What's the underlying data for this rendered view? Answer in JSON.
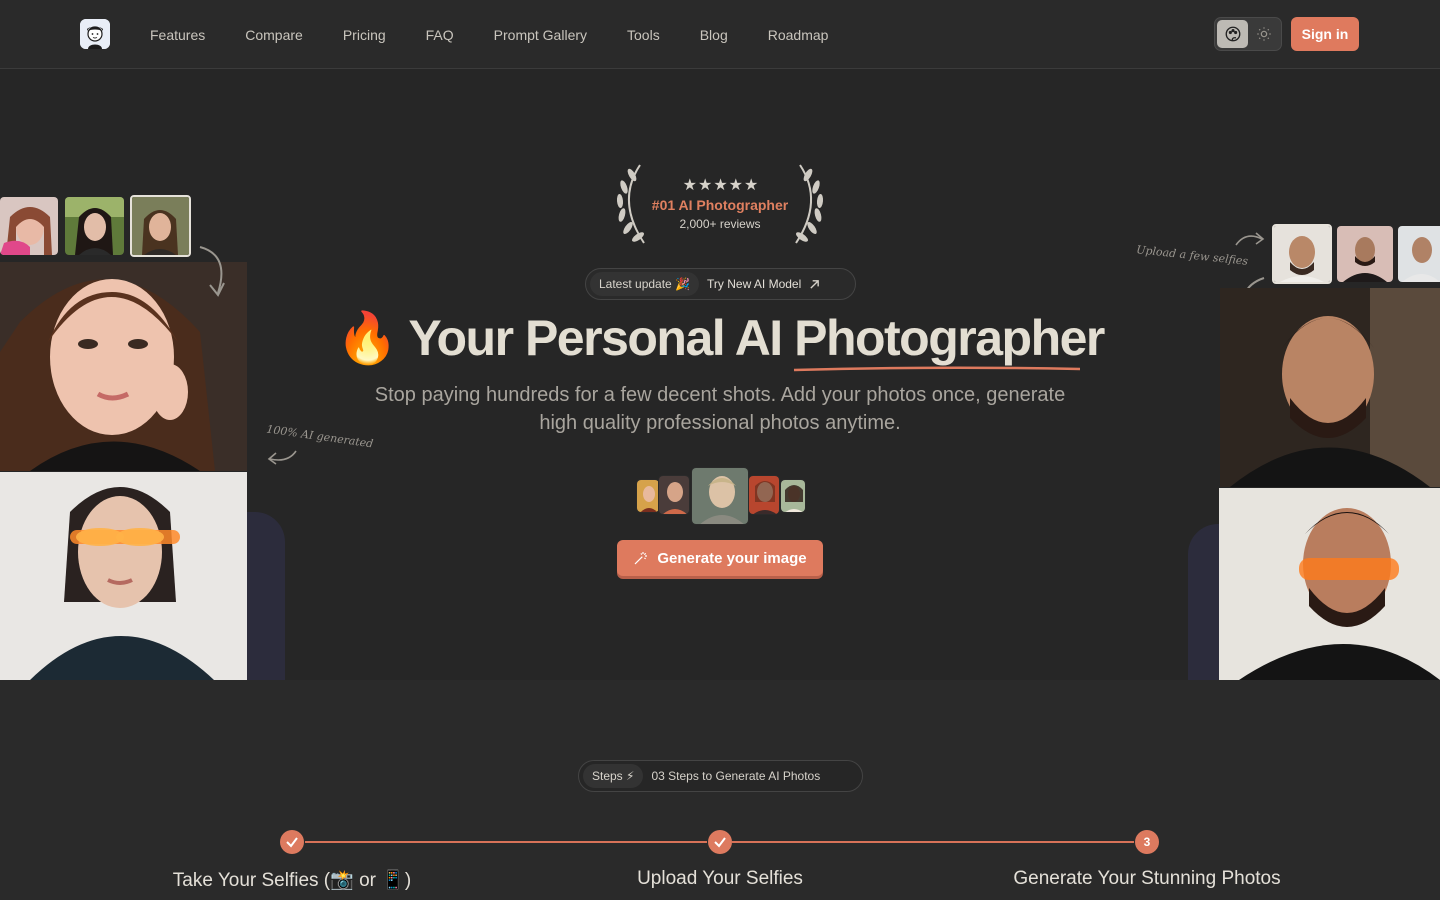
{
  "nav": {
    "items": [
      "Features",
      "Compare",
      "Pricing",
      "FAQ",
      "Prompt Gallery",
      "Tools",
      "Blog",
      "Roadmap"
    ],
    "signin_label": "Sign in"
  },
  "hero": {
    "badge": {
      "stars": "★★★★★",
      "title": "#01 AI Photographer",
      "subtitle": "2,000+ reviews"
    },
    "update": {
      "tag": "Latest update 🎉",
      "link": "Try New AI Model"
    },
    "headline_emoji": "🔥",
    "headline_main": "Your Personal AI ",
    "headline_highlight": "Photographer",
    "subtitle": "Stop paying hundreds for a few decent shots. Add your photos once, generate high quality professional photos anytime.",
    "cta_label": "Generate your image",
    "note_left": "100% AI generated",
    "note_right": "Upload a few selfies"
  },
  "steps": {
    "tag": "Steps ⚡",
    "text": "03 Steps to Generate AI Photos",
    "items": [
      {
        "label": "Take Your Selfies (📸 or 📱)",
        "status": "done",
        "marker": "✓"
      },
      {
        "label": "Upload Your Selfies",
        "status": "done",
        "marker": "✓"
      },
      {
        "label": "Generate Your Stunning Photos",
        "status": "current",
        "marker": "3"
      }
    ]
  },
  "colors": {
    "accent": "#de7a5e",
    "background": "#2a2a2a",
    "hero_bg": "#262626"
  }
}
